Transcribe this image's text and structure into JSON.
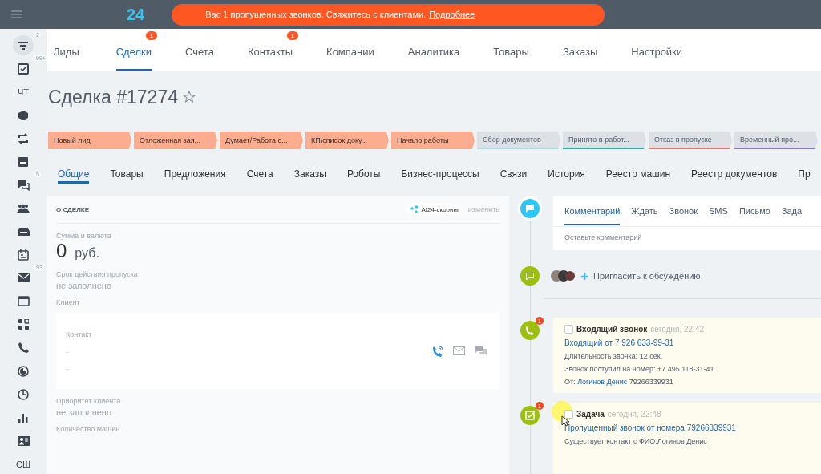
{
  "header": {
    "logo": "24",
    "notice": {
      "text": "Вас 1 пропущенных звонков. Свяжитесь с клиентами.",
      "link": "Подробнее"
    }
  },
  "sidebar": [
    {
      "kind": "filter",
      "badge": "2",
      "selected": true
    },
    {
      "kind": "task",
      "badge": "99+",
      "selected": false
    },
    {
      "kind": "text",
      "label": "ЧТ",
      "selected": false
    },
    {
      "kind": "cube",
      "selected": false
    },
    {
      "kind": "sync",
      "selected": false
    },
    {
      "kind": "window",
      "selected": false
    },
    {
      "kind": "chat",
      "badge": "5",
      "selected": false
    },
    {
      "kind": "group",
      "selected": false
    },
    {
      "kind": "drawer",
      "selected": false
    },
    {
      "kind": "calendar",
      "selected": false
    },
    {
      "kind": "mail",
      "badge": "93",
      "selected": false
    },
    {
      "kind": "browser",
      "selected": false
    },
    {
      "kind": "grid",
      "selected": false
    },
    {
      "kind": "phone",
      "selected": false
    },
    {
      "kind": "pie",
      "selected": false
    },
    {
      "kind": "clock",
      "selected": false
    },
    {
      "kind": "chart",
      "selected": false
    },
    {
      "kind": "contact",
      "selected": false
    },
    {
      "kind": "text",
      "label": "СШ",
      "selected": false
    }
  ],
  "nav_tabs": [
    {
      "label": "Лиды",
      "selected": false
    },
    {
      "label": "Сделки",
      "selected": true,
      "badge": "1"
    },
    {
      "label": "Счета",
      "selected": false
    },
    {
      "label": "Контакты",
      "selected": false,
      "badge": "1"
    },
    {
      "label": "Компании",
      "selected": false
    },
    {
      "label": "Аналитика",
      "selected": false
    },
    {
      "label": "Товары",
      "selected": false
    },
    {
      "label": "Заказы",
      "selected": false
    },
    {
      "label": "Настройки",
      "selected": false
    }
  ],
  "title": "Сделка #17274",
  "stages": [
    {
      "label": "Новый лид",
      "passed": true
    },
    {
      "label": "Отложенная зая...",
      "passed": true
    },
    {
      "label": "Думает/Работа с...",
      "passed": true
    },
    {
      "label": "КП/список доку...",
      "passed": true
    },
    {
      "label": "Начало работы",
      "passed": true
    },
    {
      "label": "Сбор документов",
      "passed": false,
      "color": "#a9dde3"
    },
    {
      "label": "Принято в работ...",
      "passed": false,
      "color": "#2ab3a3"
    },
    {
      "label": "Отказ в пропуске",
      "passed": false,
      "color": "#e8746a"
    },
    {
      "label": "Временный про...",
      "passed": false,
      "color": "#8c7ac4"
    }
  ],
  "deal_tabs": [
    {
      "label": "Общие",
      "selected": true
    },
    {
      "label": "Товары",
      "selected": false
    },
    {
      "label": "Предложения",
      "selected": false
    },
    {
      "label": "Счета",
      "selected": false
    },
    {
      "label": "Заказы",
      "selected": false
    },
    {
      "label": "Роботы",
      "selected": false
    },
    {
      "label": "Бизнес-процессы",
      "selected": false
    },
    {
      "label": "Связи",
      "selected": false
    },
    {
      "label": "История",
      "selected": false
    },
    {
      "label": "Реестр машин",
      "selected": false
    },
    {
      "label": "Реестр документов",
      "selected": false
    },
    {
      "label": "Пр",
      "selected": false
    }
  ],
  "about": {
    "heading": "О СДЕЛКЕ",
    "scoring": "AI24-скоринг",
    "edit": "изменить",
    "amount_label": "Сумма и валюта",
    "amount": "0",
    "currency": "руб.",
    "pass_label": "Срок действия пропуска",
    "pass_value": "не заполнено",
    "client_label": "Клиент",
    "contact_label": "Контакт",
    "contact_lines": [
      "–",
      "–"
    ],
    "priority_label": "Приоритет клиента",
    "priority_value": "не заполнено",
    "cars_label": "Количество машин"
  },
  "timeline": {
    "editor_tabs": [
      {
        "label": "Комментарий",
        "selected": true
      },
      {
        "label": "Ждать",
        "selected": false
      },
      {
        "label": "Звонок",
        "selected": false
      },
      {
        "label": "SMS",
        "selected": false
      },
      {
        "label": "Письмо",
        "selected": false
      },
      {
        "label": "Зада",
        "selected": false
      }
    ],
    "comment_placeholder": "Оставьте комментарий",
    "invite": "Пригласить к обсуждению",
    "items": [
      {
        "kind": "call",
        "badge": "1",
        "checked": false,
        "title": "Входящий звонок",
        "time": "сегодня, 22:42",
        "link": "Входящий от 7 926 633-99-31",
        "lines": [
          "Длительность звонка: 12 сек.",
          "Звонок поступил на номер: +7 495 118-31-41."
        ],
        "from_label": "От:",
        "from_name": "Логинов Денис",
        "from_phone": "79266339931"
      },
      {
        "kind": "task",
        "badge": "1",
        "checked": false,
        "title": "Задача",
        "time": "сегодня, 22:48",
        "link": "Пропущенный звонок от номера 79266339931",
        "lines": [
          "Существует контакт с ФИО:Логинов Денис ,"
        ]
      }
    ]
  }
}
